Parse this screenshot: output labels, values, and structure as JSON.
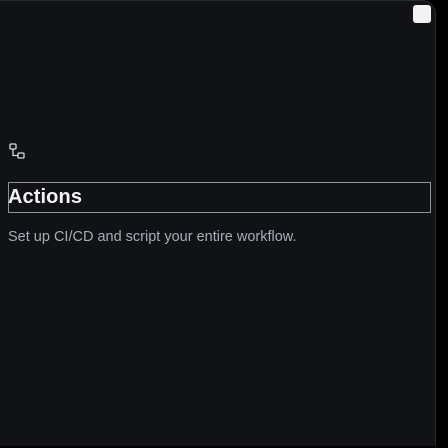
{
  "feature": {
    "icon": "workflow-icon",
    "title": "Actions",
    "description": "Set up CI/CD and script your entire workflow."
  },
  "colors": {
    "background": "#101215",
    "title": "#f4f4f5",
    "description": "#a7adb6",
    "border": "#8a93a0"
  }
}
